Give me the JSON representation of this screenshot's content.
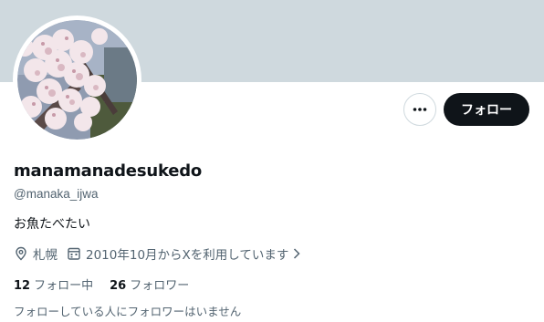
{
  "profile": {
    "display_name": "manamanadesukedo",
    "handle": "@manaka_ijwa",
    "bio": "お魚たべたい",
    "location": "札幌",
    "joined": "2010年10月からXを利用しています"
  },
  "actions": {
    "follow_label": "フォロー",
    "more_icon": "more-horizontal-icon"
  },
  "stats": {
    "following_count": "12",
    "following_label": "フォロー中",
    "followers_count": "26",
    "followers_label": "フォロワー"
  },
  "followers_note": "フォローしている人にフォロワーはいません",
  "colors": {
    "banner": "#cfd9de",
    "text_primary": "#0f1419",
    "text_secondary": "#536471",
    "button_dark": "#0f1419"
  },
  "icons": {
    "location": "location-pin-icon",
    "joined": "calendar-icon",
    "chevron": "chevron-right-icon"
  }
}
